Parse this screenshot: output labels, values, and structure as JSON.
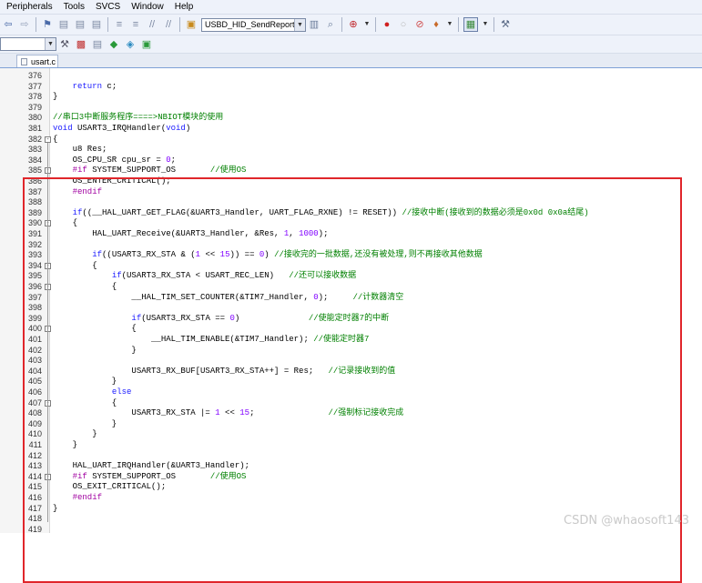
{
  "menu": [
    "Peripherals",
    "Tools",
    "SVCS",
    "Window",
    "Help"
  ],
  "toolbar": {
    "target_name": "USBD_HID_SendReport"
  },
  "tab": {
    "label": "usart.c"
  },
  "watermark": "CSDN @whaosoft143",
  "colors": {
    "keyword": "#1a1aff",
    "preprocessor": "#a000a0",
    "comment": "#008000",
    "number": "#8000ff",
    "highlight_border": "#e0262b"
  },
  "code_lines": [
    {
      "n": "376",
      "fold": "",
      "segs": []
    },
    {
      "n": "377",
      "fold": "",
      "segs": [
        {
          "t": "    "
        },
        {
          "t": "return",
          "c": "kw"
        },
        {
          "t": " c;"
        }
      ]
    },
    {
      "n": "378",
      "fold": "",
      "segs": [
        {
          "t": "}"
        }
      ]
    },
    {
      "n": "379",
      "fold": "",
      "segs": []
    },
    {
      "n": "380",
      "fold": "",
      "segs": [
        {
          "t": "//串口3中断服务程序====>NBIOT模块的使用",
          "c": "cm"
        }
      ]
    },
    {
      "n": "381",
      "fold": "",
      "segs": [
        {
          "t": "void",
          "c": "kw"
        },
        {
          "t": " USART3_IRQHandler("
        },
        {
          "t": "void",
          "c": "kw"
        },
        {
          "t": ")"
        }
      ]
    },
    {
      "n": "382",
      "fold": "minus",
      "segs": [
        {
          "t": "{"
        }
      ]
    },
    {
      "n": "383",
      "fold": "",
      "segs": [
        {
          "t": "    u8 Res;"
        }
      ]
    },
    {
      "n": "384",
      "fold": "",
      "segs": [
        {
          "t": "    OS_CPU_SR cpu_sr = "
        },
        {
          "t": "0",
          "c": "num"
        },
        {
          "t": ";"
        }
      ]
    },
    {
      "n": "385",
      "fold": "minus",
      "segs": [
        {
          "t": "    "
        },
        {
          "t": "#if",
          "c": "pp"
        },
        {
          "t": " SYSTEM_SUPPORT_OS       "
        },
        {
          "t": "//使用OS",
          "c": "cm"
        }
      ]
    },
    {
      "n": "386",
      "fold": "",
      "segs": [
        {
          "t": "    OS_ENTER_CRITICAL();"
        }
      ]
    },
    {
      "n": "387",
      "fold": "",
      "segs": [
        {
          "t": "    "
        },
        {
          "t": "#endif",
          "c": "pp"
        }
      ]
    },
    {
      "n": "388",
      "fold": "",
      "segs": []
    },
    {
      "n": "389",
      "fold": "",
      "segs": [
        {
          "t": "    "
        },
        {
          "t": "if",
          "c": "kw"
        },
        {
          "t": "((__HAL_UART_GET_FLAG(&UART3_Handler, UART_FLAG_RXNE) != RESET)) "
        },
        {
          "t": "//接收中断(接收到的数据必须是0x0d 0x0a结尾)",
          "c": "cm"
        }
      ]
    },
    {
      "n": "390",
      "fold": "minus",
      "segs": [
        {
          "t": "    {"
        }
      ]
    },
    {
      "n": "391",
      "fold": "",
      "segs": [
        {
          "t": "        HAL_UART_Receive(&UART3_Handler, &Res, "
        },
        {
          "t": "1",
          "c": "num"
        },
        {
          "t": ", "
        },
        {
          "t": "1000",
          "c": "num"
        },
        {
          "t": ");"
        }
      ]
    },
    {
      "n": "392",
      "fold": "",
      "segs": []
    },
    {
      "n": "393",
      "fold": "",
      "segs": [
        {
          "t": "        "
        },
        {
          "t": "if",
          "c": "kw"
        },
        {
          "t": "((USART3_RX_STA & ("
        },
        {
          "t": "1",
          "c": "num"
        },
        {
          "t": " << "
        },
        {
          "t": "15",
          "c": "num"
        },
        {
          "t": ")) == "
        },
        {
          "t": "0",
          "c": "num"
        },
        {
          "t": ") "
        },
        {
          "t": "//接收完的一批数据,还没有被处理,则不再接收其他数据",
          "c": "cm"
        }
      ]
    },
    {
      "n": "394",
      "fold": "minus",
      "segs": [
        {
          "t": "        {"
        }
      ]
    },
    {
      "n": "395",
      "fold": "",
      "segs": [
        {
          "t": "            "
        },
        {
          "t": "if",
          "c": "kw"
        },
        {
          "t": "(USART3_RX_STA < USART_REC_LEN)   "
        },
        {
          "t": "//还可以接收数据",
          "c": "cm"
        }
      ]
    },
    {
      "n": "396",
      "fold": "minus",
      "segs": [
        {
          "t": "            {"
        }
      ]
    },
    {
      "n": "397",
      "fold": "",
      "segs": [
        {
          "t": "                __HAL_TIM_SET_COUNTER(&TIM7_Handler, "
        },
        {
          "t": "0",
          "c": "num"
        },
        {
          "t": ");     "
        },
        {
          "t": "//计数器清空",
          "c": "cm"
        }
      ]
    },
    {
      "n": "398",
      "fold": "",
      "segs": []
    },
    {
      "n": "399",
      "fold": "",
      "segs": [
        {
          "t": "                "
        },
        {
          "t": "if",
          "c": "kw"
        },
        {
          "t": "(USART3_RX_STA == "
        },
        {
          "t": "0",
          "c": "num"
        },
        {
          "t": ")              "
        },
        {
          "t": "//使能定时器7的中断",
          "c": "cm"
        }
      ]
    },
    {
      "n": "400",
      "fold": "minus",
      "segs": [
        {
          "t": "                {"
        }
      ]
    },
    {
      "n": "401",
      "fold": "",
      "segs": [
        {
          "t": "                    __HAL_TIM_ENABLE(&TIM7_Handler); "
        },
        {
          "t": "//使能定时器7",
          "c": "cm"
        }
      ]
    },
    {
      "n": "402",
      "fold": "",
      "segs": [
        {
          "t": "                }"
        }
      ]
    },
    {
      "n": "403",
      "fold": "",
      "segs": []
    },
    {
      "n": "404",
      "fold": "",
      "segs": [
        {
          "t": "                USART3_RX_BUF[USART3_RX_STA++] = Res;   "
        },
        {
          "t": "//记录接收到的值",
          "c": "cm"
        }
      ]
    },
    {
      "n": "405",
      "fold": "",
      "segs": [
        {
          "t": "            }"
        }
      ]
    },
    {
      "n": "406",
      "fold": "",
      "segs": [
        {
          "t": "            "
        },
        {
          "t": "else",
          "c": "kw"
        }
      ]
    },
    {
      "n": "407",
      "fold": "minus",
      "segs": [
        {
          "t": "            {"
        }
      ]
    },
    {
      "n": "408",
      "fold": "",
      "segs": [
        {
          "t": "                USART3_RX_STA |= "
        },
        {
          "t": "1",
          "c": "num"
        },
        {
          "t": " << "
        },
        {
          "t": "15",
          "c": "num"
        },
        {
          "t": ";               "
        },
        {
          "t": "//强制标记接收完成",
          "c": "cm"
        }
      ]
    },
    {
      "n": "409",
      "fold": "",
      "segs": [
        {
          "t": "            }"
        }
      ]
    },
    {
      "n": "410",
      "fold": "",
      "segs": [
        {
          "t": "        }"
        }
      ]
    },
    {
      "n": "411",
      "fold": "",
      "segs": [
        {
          "t": "    }"
        }
      ]
    },
    {
      "n": "412",
      "fold": "",
      "segs": []
    },
    {
      "n": "413",
      "fold": "",
      "segs": [
        {
          "t": "    HAL_UART_IRQHandler(&UART3_Handler);"
        }
      ]
    },
    {
      "n": "414",
      "fold": "minus",
      "segs": [
        {
          "t": "    "
        },
        {
          "t": "#if",
          "c": "pp"
        },
        {
          "t": " SYSTEM_SUPPORT_OS       "
        },
        {
          "t": "//使用OS",
          "c": "cm"
        }
      ]
    },
    {
      "n": "415",
      "fold": "",
      "segs": [
        {
          "t": "    OS_EXIT_CRITICAL();"
        }
      ]
    },
    {
      "n": "416",
      "fold": "",
      "segs": [
        {
          "t": "    "
        },
        {
          "t": "#endif",
          "c": "pp"
        }
      ]
    },
    {
      "n": "417",
      "fold": "",
      "segs": [
        {
          "t": "}"
        }
      ]
    },
    {
      "n": "418",
      "fold": "",
      "segs": []
    },
    {
      "n": "419",
      "fold": "",
      "segs": []
    }
  ]
}
